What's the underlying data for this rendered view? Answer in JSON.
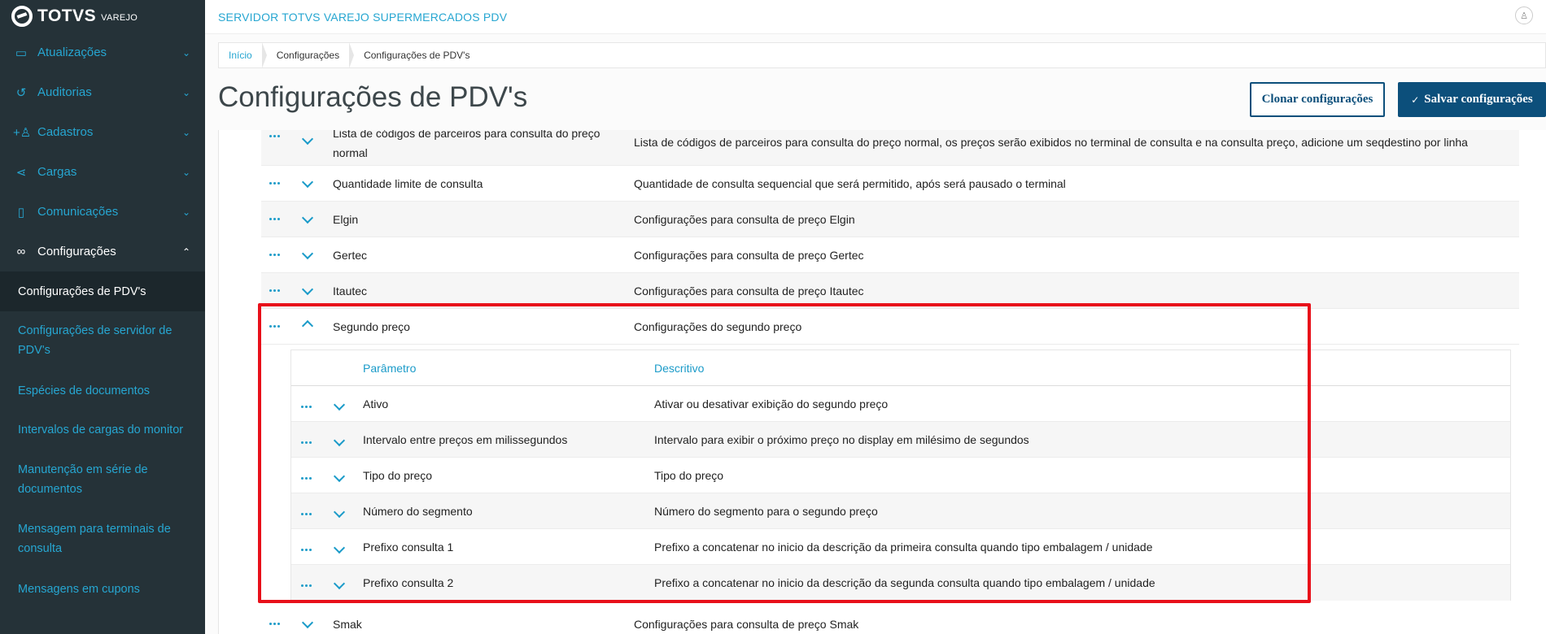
{
  "app": {
    "logo_text": "TOTVS",
    "logo_sub": "VAREJO",
    "server_name": "SERVIDOR TOTVS VAREJO SUPERMERCADOS PDV",
    "user_icon": "user-icon"
  },
  "sidebar": {
    "items": [
      {
        "label": "Atualizações",
        "icon": "server-icon"
      },
      {
        "label": "Auditorias",
        "icon": "history-icon"
      },
      {
        "label": "Cadastros",
        "icon": "add-user-icon"
      },
      {
        "label": "Cargas",
        "icon": "share-icon"
      },
      {
        "label": "Comunicações",
        "icon": "phone-icon"
      },
      {
        "label": "Configurações",
        "icon": "link-icon"
      }
    ],
    "sub_items": [
      "Configurações de PDV's",
      "Configurações de servidor de PDV's",
      "Espécies de documentos",
      "Intervalos de cargas do monitor",
      "Manutenção em série de documentos",
      "Mensagem para terminais de consulta",
      "Mensagens em cupons"
    ]
  },
  "breadcrumb": [
    "Início",
    "Configurações",
    "Configurações de PDV's"
  ],
  "page": {
    "title": "Configurações de PDV's",
    "clone_label": "Clonar configurações",
    "save_label": "Salvar configurações"
  },
  "rows": [
    {
      "param": "Lista de códigos de parceiros para consulta do preço normal",
      "desc": "Lista de códigos de parceiros para consulta do preço normal, os preços serão exibidos no terminal de consulta e na consulta preço, adicione um seqdestino por linha"
    },
    {
      "param": "Quantidade limite de consulta",
      "desc": "Quantidade de consulta sequencial que será permitido, após será pausado o terminal"
    },
    {
      "param": "Elgin",
      "desc": "Configurações para consulta de preço Elgin"
    },
    {
      "param": "Gertec",
      "desc": "Configurações para consulta de preço Gertec"
    },
    {
      "param": "Itautec",
      "desc": "Configurações para consulta de preço Itautec"
    },
    {
      "param": "Segundo preço",
      "desc": "Configurações do segundo preço"
    },
    {
      "param": "Smak",
      "desc": "Configurações para consulta de preço Smak"
    }
  ],
  "sub_table": {
    "headers": {
      "param": "Parâmetro",
      "desc": "Descritivo"
    },
    "rows": [
      {
        "param": "Ativo",
        "desc": "Ativar ou desativar exibição do segundo preço"
      },
      {
        "param": "Intervalo entre preços em milissegundos",
        "desc": "Intervalo para exibir o próximo preço no display em milésimo de segundos"
      },
      {
        "param": "Tipo do preço",
        "desc": "Tipo do preço"
      },
      {
        "param": "Número do segmento",
        "desc": "Número do segmento para o segundo preço"
      },
      {
        "param": "Prefixo consulta 1",
        "desc": "Prefixo a concatenar no inicio da descrição da primeira consulta quando tipo embalagem / unidade"
      },
      {
        "param": "Prefixo consulta 2",
        "desc": "Prefixo a concatenar no inicio da descrição da segunda consulta quando tipo embalagem / unidade"
      }
    ]
  },
  "colors": {
    "sidebar_bg": "#253238",
    "accent": "#26a6d1",
    "primary_button": "#0c4f7b",
    "highlight": "#e8101a"
  }
}
